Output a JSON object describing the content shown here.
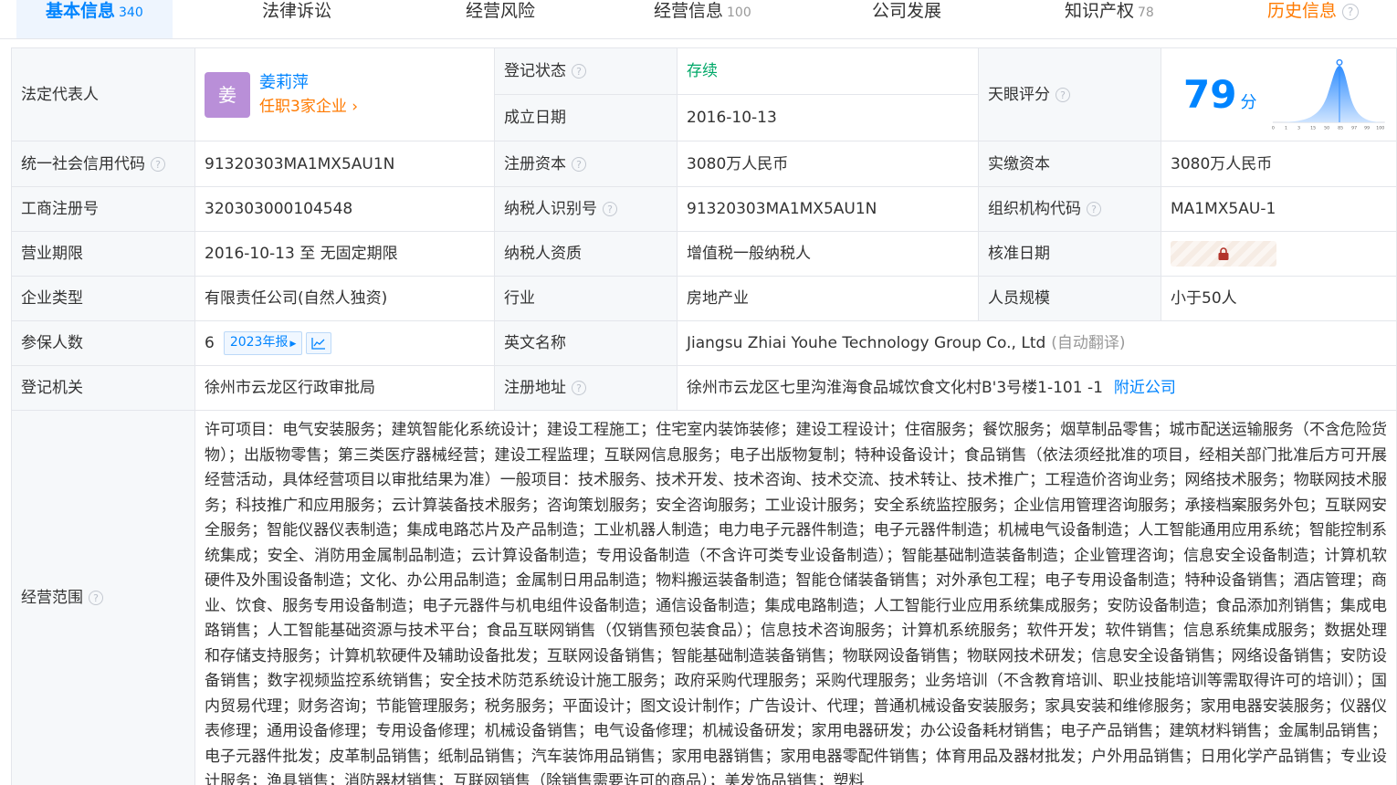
{
  "tabs": [
    {
      "label": "基本信息",
      "count": "340"
    },
    {
      "label": "法律诉讼",
      "count": ""
    },
    {
      "label": "经营风险",
      "count": ""
    },
    {
      "label": "经营信息",
      "count": "100"
    },
    {
      "label": "公司发展",
      "count": ""
    },
    {
      "label": "知识产权",
      "count": "78"
    },
    {
      "label": "历史信息",
      "count": ""
    }
  ],
  "info": {
    "legal_rep": {
      "label": "法定代表人",
      "avatar": "姜",
      "name": "姜莉萍",
      "link": "任职3家企业"
    },
    "reg_status": {
      "label": "登记状态",
      "value": "存续"
    },
    "found_date": {
      "label": "成立日期",
      "value": "2016-10-13"
    },
    "tianyan_score": {
      "label": "天眼评分",
      "value": "79",
      "unit": "分"
    },
    "score_axis": [
      "0",
      "1",
      "3",
      "15",
      "50",
      "85",
      "97",
      "99",
      "100"
    ],
    "credit_code": {
      "label": "统一社会信用代码",
      "value": "91320303MA1MX5AU1N"
    },
    "reg_capital": {
      "label": "注册资本",
      "value": "3080万人民币"
    },
    "paid_capital": {
      "label": "实缴资本",
      "value": "3080万人民币"
    },
    "biz_reg_no": {
      "label": "工商注册号",
      "value": "320303000104548"
    },
    "taxpayer_id": {
      "label": "纳税人识别号",
      "value": "91320303MA1MX5AU1N"
    },
    "org_code": {
      "label": "组织机构代码",
      "value": "MA1MX5AU-1"
    },
    "biz_term": {
      "label": "营业期限",
      "value": "2016-10-13 至 无固定期限"
    },
    "taxpayer_qual": {
      "label": "纳税人资质",
      "value": "增值税一般纳税人"
    },
    "approve_date": {
      "label": "核准日期"
    },
    "company_type": {
      "label": "企业类型",
      "value": "有限责任公司(自然人独资)"
    },
    "industry": {
      "label": "行业",
      "value": "房地产业"
    },
    "staff_size": {
      "label": "人员规模",
      "value": "小于50人"
    },
    "insured": {
      "label": "参保人数",
      "value": "6",
      "report": "2023年报"
    },
    "english_name": {
      "label": "英文名称",
      "value": "Jiangsu Zhiai Youhe Technology Group Co., Ltd",
      "note": "(自动翻译)"
    },
    "reg_authority": {
      "label": "登记机关",
      "value": "徐州市云龙区行政审批局"
    },
    "reg_address": {
      "label": "注册地址",
      "value": "徐州市云龙区七里沟淮海食品城饮食文化村B'3号楼1-101 -1",
      "link": "附近公司"
    },
    "scope": {
      "label": "经营范围",
      "value": "许可项目：电气安装服务；建筑智能化系统设计；建设工程施工；住宅室内装饰装修；建设工程设计；住宿服务；餐饮服务；烟草制品零售；城市配送运输服务（不含危险货物）；出版物零售；第三类医疗器械经营；建设工程监理；互联网信息服务；电子出版物复制；特种设备设计；食品销售（依法须经批准的项目，经相关部门批准后方可开展经营活动，具体经营项目以审批结果为准）一般项目：技术服务、技术开发、技术咨询、技术交流、技术转让、技术推广；工程造价咨询业务；网络技术服务；物联网技术服务；科技推广和应用服务；云计算装备技术服务；咨询策划服务；安全咨询服务；工业设计服务；安全系统监控服务；企业信用管理咨询服务；承接档案服务外包；互联网安全服务；智能仪器仪表制造；集成电路芯片及产品制造；工业机器人制造；电力电子元器件制造；电子元器件制造；机械电气设备制造；人工智能通用应用系统；智能控制系统集成；安全、消防用金属制品制造；云计算设备制造；专用设备制造（不含许可类专业设备制造）；智能基础制造装备制造；企业管理咨询；信息安全设备制造；计算机软硬件及外围设备制造；文化、办公用品制造；金属制日用品制造；物料搬运装备制造；智能仓储装备销售；对外承包工程；电子专用设备制造；特种设备销售；酒店管理；商业、饮食、服务专用设备制造；电子元器件与机电组件设备制造；通信设备制造；集成电路制造；人工智能行业应用系统集成服务；安防设备制造；食品添加剂销售；集成电路销售；人工智能基础资源与技术平台；食品互联网销售（仅销售预包装食品）；信息技术咨询服务；计算机系统服务；软件开发；软件销售；信息系统集成服务；数据处理和存储支持服务；计算机软硬件及辅助设备批发；互联网设备销售；智能基础制造装备销售；物联网设备销售；物联网技术研发；信息安全设备销售；网络设备销售；安防设备销售；数字视频监控系统销售；安全技术防范系统设计施工服务；政府采购代理服务；采购代理服务；业务培训（不含教育培训、职业技能培训等需取得许可的培训）；国内贸易代理；财务咨询；节能管理服务；税务服务；平面设计；图文设计制作；广告设计、代理；普通机械设备安装服务；家具安装和维修服务；家用电器安装服务；仪器仪表修理；通用设备修理；专用设备修理；机械设备销售；电气设备修理；机械设备研发；家用电器研发；办公设备耗材销售；电子产品销售；建筑材料销售；金属制品销售；电子元器件批发；皮革制品销售；纸制品销售；汽车装饰用品销售；家用电器销售；家用电器零配件销售；体育用品及器材批发；户外用品销售；日用化学产品销售；专业设计服务；渔具销售；消防器材销售；互联网销售（除销售需要许可的商品）；美发饰品销售；塑料"
    }
  },
  "colors": {
    "accent": "#0084ff",
    "orange": "#ff7a00",
    "green": "#00a868",
    "label_bg": "#f6f8fa",
    "avatar": "#b98fd8"
  }
}
